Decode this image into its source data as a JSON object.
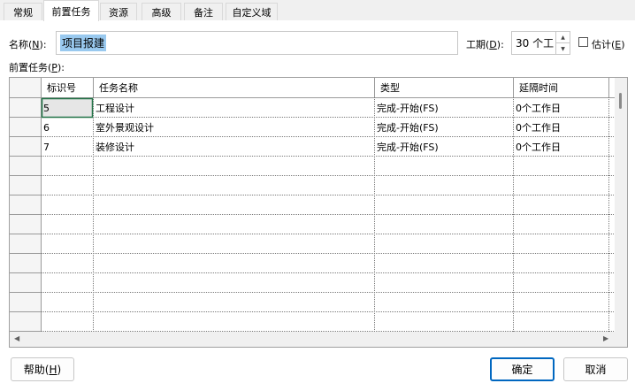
{
  "tabs": [
    {
      "label": "常规"
    },
    {
      "label": "前置任务"
    },
    {
      "label": "资源"
    },
    {
      "label": "高级"
    },
    {
      "label": "备注"
    },
    {
      "label": "自定义域"
    }
  ],
  "name_field": {
    "label": "名称(",
    "accel": "N",
    "label_end": "):",
    "value": "项目报建"
  },
  "duration_field": {
    "label": "工期(",
    "accel": "D",
    "label_end": "):",
    "value": "30 个工"
  },
  "estimate": {
    "label": "估计(",
    "accel": "E",
    "label_end": ")",
    "checked": false
  },
  "predecessors_label": {
    "label": "前置任务(",
    "accel": "P",
    "label_end": "):"
  },
  "grid": {
    "columns": [
      "标识号",
      "任务名称",
      "类型",
      "延隔时间"
    ],
    "rows": [
      {
        "id": "5",
        "name": "工程设计",
        "type": "完成-开始(FS)",
        "lag": "0个工作日"
      },
      {
        "id": "6",
        "name": "室外景观设计",
        "type": "完成-开始(FS)",
        "lag": "0个工作日"
      },
      {
        "id": "7",
        "name": "装修设计",
        "type": "完成-开始(FS)",
        "lag": "0个工作日"
      }
    ]
  },
  "buttons": {
    "help": {
      "label": "帮助(",
      "accel": "H",
      "label_end": ")"
    },
    "ok": "确定",
    "cancel": "取消"
  },
  "colors": {
    "selection": "#99c9ef",
    "default_button": "#0067c0",
    "active_cell_border": "#217346"
  }
}
